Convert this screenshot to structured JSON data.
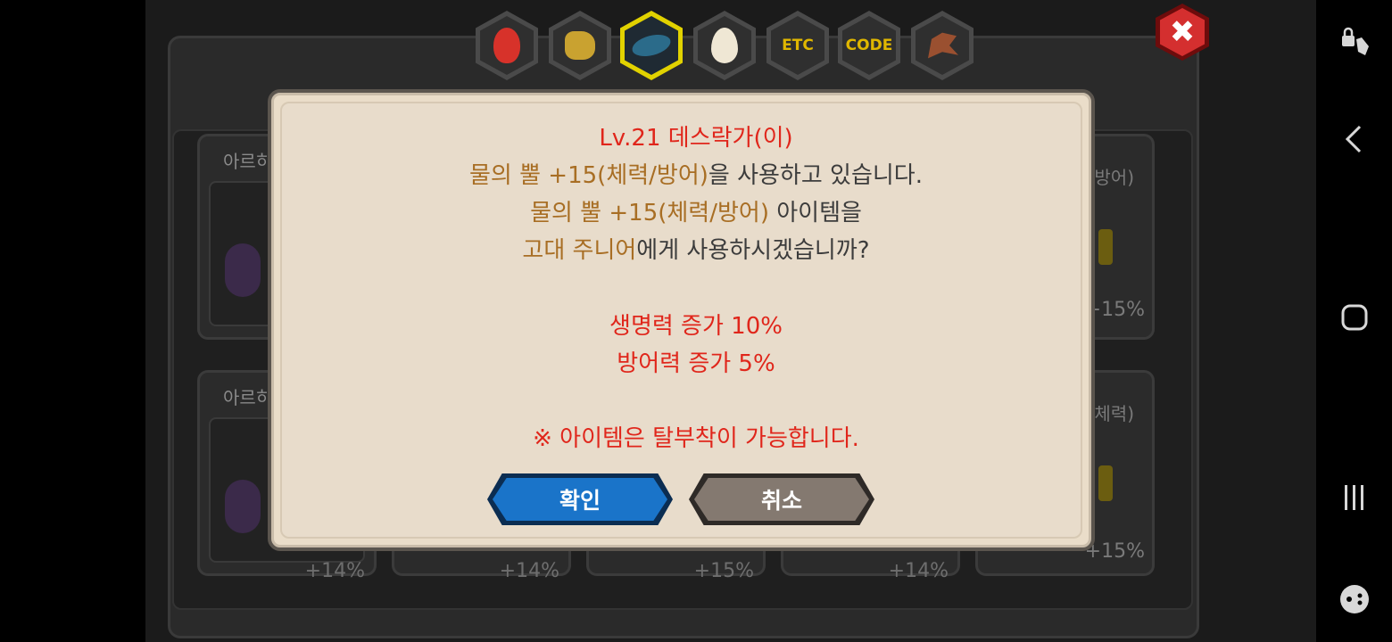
{
  "tabs": [
    {
      "name": "fruit",
      "label": ""
    },
    {
      "name": "ore",
      "label": ""
    },
    {
      "name": "fish",
      "label": ""
    },
    {
      "name": "egg",
      "label": ""
    },
    {
      "name": "etc",
      "label": "ETC"
    },
    {
      "name": "code",
      "label": "CODE"
    },
    {
      "name": "dragon",
      "label": ""
    }
  ],
  "close_label": "✖",
  "background_cards": {
    "left_top_name": "아르히",
    "left_bottom_name": "아르히",
    "left_bottom_pct": "+14%",
    "col2_pct": "+14%",
    "col3_pct": "+15%",
    "col4_pct": "+14%",
    "right_top_label": "방어)",
    "right_top_pct": "+15%",
    "right_bottom_label": "체력)",
    "right_bottom_pct": "+15%"
  },
  "dialog": {
    "line1": "Lv.21 데스락가(이)",
    "line2_item": "물의 뿔 +15(체력/방어)",
    "line2_rest": "을 사용하고 있습니다.",
    "line3_item": "물의 뿔 +15(체력/방어)",
    "line3_rest": " 아이템을",
    "line4_target": "고대 주니어",
    "line4_rest": "에게 사용하시겠습니까?",
    "stat1": "생명력 증가 10%",
    "stat2": "방어력 증가 5%",
    "note": "※ 아이템은 탈부착이 가능합니다.",
    "confirm_label": "확인",
    "cancel_label": "취소"
  },
  "navbar": {
    "icons": [
      "touch-lock-icon",
      "back-icon",
      "home-icon",
      "recents-icon",
      "game-tools-icon"
    ]
  },
  "colors": {
    "accent_red": "#e0261b",
    "accent_gold": "#a86e24",
    "confirm_blue": "#1a74c9",
    "cancel_gray": "#847970",
    "active_tab_border": "#e1d200"
  }
}
